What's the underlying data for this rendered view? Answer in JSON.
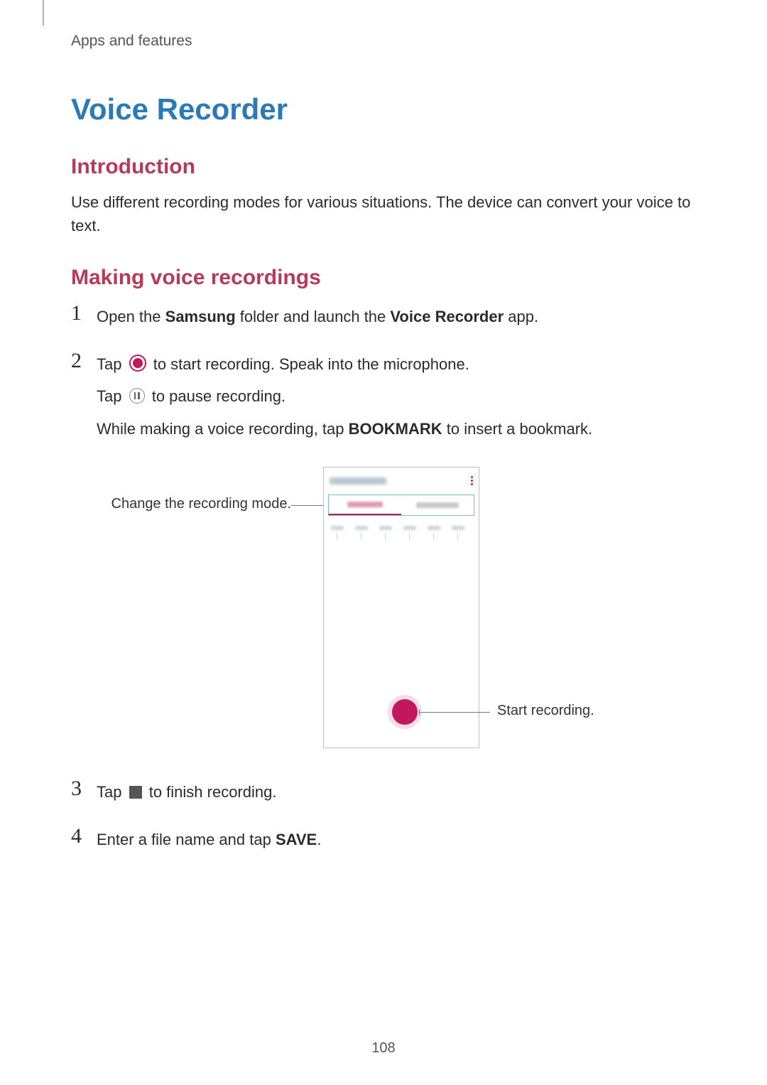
{
  "header": {
    "section_label": "Apps and features"
  },
  "title": "Voice Recorder",
  "intro": {
    "heading": "Introduction",
    "body": "Use different recording modes for various situations. The device can convert your voice to text."
  },
  "making": {
    "heading": "Making voice recordings",
    "steps": {
      "s1": {
        "num": "1",
        "pre": "Open the ",
        "b1": "Samsung",
        "mid": " folder and launch the ",
        "b2": "Voice Recorder",
        "post": " app."
      },
      "s2": {
        "num": "2",
        "l1_pre": "Tap ",
        "l1_post": " to start recording. Speak into the microphone.",
        "l2_pre": "Tap ",
        "l2_post": " to pause recording.",
        "l3_pre": "While making a voice recording, tap ",
        "l3_bold": "BOOKMARK",
        "l3_post": " to insert a bookmark."
      },
      "s3": {
        "num": "3",
        "pre": "Tap ",
        "post": " to finish recording."
      },
      "s4": {
        "num": "4",
        "pre": "Enter a file name and tap ",
        "bold": "SAVE",
        "post": "."
      }
    }
  },
  "figure": {
    "callout_left": "Change the recording mode.",
    "callout_right": "Start recording."
  },
  "page_number": "108"
}
